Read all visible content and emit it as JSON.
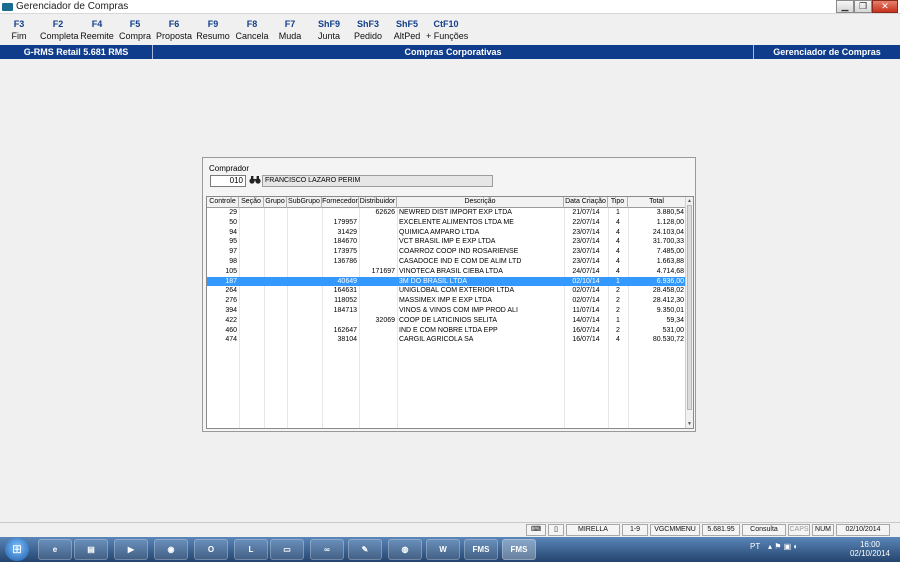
{
  "window": {
    "title": "Gerenciador de Compras"
  },
  "fkeys": [
    {
      "key": "F3",
      "label": "Fim"
    },
    {
      "key": "F2",
      "label": "Completa"
    },
    {
      "key": "F4",
      "label": "Reemite"
    },
    {
      "key": "F5",
      "label": "Compra"
    },
    {
      "key": "F6",
      "label": "Proposta"
    },
    {
      "key": "F9",
      "label": "Resumo"
    },
    {
      "key": "F8",
      "label": "Cancela"
    },
    {
      "key": "F7",
      "label": "Muda"
    },
    {
      "key": "ShF9",
      "label": "Junta"
    },
    {
      "key": "ShF3",
      "label": "Pedido"
    },
    {
      "key": "ShF5",
      "label": "AltPed"
    },
    {
      "key": "CtF10",
      "label": "+ Funções"
    }
  ],
  "top_status": {
    "left": "G-RMS Retail 5.681 RMS",
    "center": "Compras Corporativas",
    "right": "Gerenciador de Compras"
  },
  "comprador": {
    "label": "Comprador",
    "code": "010",
    "name": "FRANCISCO LAZARO PERIM"
  },
  "table": {
    "columns": [
      "Controle",
      "Seção",
      "Grupo",
      "SubGrupo",
      "Fornecedor",
      "Distribuidor",
      "Descrição",
      "Data Criação",
      "Tipo",
      "Total"
    ],
    "selected_index": 7,
    "rows": [
      [
        "29",
        "",
        "",
        "",
        "",
        "62626",
        "NEWRED DIST IMPORT EXP LTDA",
        "21/07/14",
        "1",
        "3.880,54"
      ],
      [
        "50",
        "",
        "",
        "",
        "179957",
        "",
        "EXCELENTE ALIMENTOS LTDA ME",
        "22/07/14",
        "4",
        "1.128,00"
      ],
      [
        "94",
        "",
        "",
        "",
        "31429",
        "",
        "QUIMICA AMPARO LTDA",
        "23/07/14",
        "4",
        "24.103,04"
      ],
      [
        "95",
        "",
        "",
        "",
        "184670",
        "",
        "VCT BRASIL IMP E EXP LTDA",
        "23/07/14",
        "4",
        "31.700,33"
      ],
      [
        "97",
        "",
        "",
        "",
        "173975",
        "",
        "COARROZ COOP IND ROSARIENSE",
        "23/07/14",
        "4",
        "7.485,00"
      ],
      [
        "98",
        "",
        "",
        "",
        "136786",
        "",
        "CASADOCE IND E COM DE ALIM LTD",
        "23/07/14",
        "4",
        "1.663,88"
      ],
      [
        "105",
        "",
        "",
        "",
        "",
        "171697",
        "VINOTECA BRASIL CIEBA LTDA",
        "24/07/14",
        "4",
        "4.714,68"
      ],
      [
        "187",
        "",
        "",
        "",
        "40649",
        "",
        "3M DO BRASIL LTDA",
        "02/10/14",
        "1",
        "6.936,00"
      ],
      [
        "264",
        "",
        "",
        "",
        "164631",
        "",
        "UNIGLOBAL COM EXTERIOR LTDA",
        "02/07/14",
        "2",
        "28.458,02"
      ],
      [
        "276",
        "",
        "",
        "",
        "118052",
        "",
        "MASSIMEX IMP E EXP LTDA",
        "02/07/14",
        "2",
        "28.412,30"
      ],
      [
        "394",
        "",
        "",
        "",
        "184713",
        "",
        "VINOS & VINOS COM IMP PROD ALI",
        "11/07/14",
        "2",
        "9.350,01"
      ],
      [
        "422",
        "",
        "",
        "",
        "",
        "32069",
        "COOP DE LATICINIOS SELITA",
        "14/07/14",
        "1",
        "59,34"
      ],
      [
        "460",
        "",
        "",
        "",
        "162647",
        "",
        "IND E COM NOBRE LTDA EPP",
        "16/07/14",
        "2",
        "531,00"
      ],
      [
        "474",
        "",
        "",
        "",
        "38104",
        "",
        "CARGIL AGRICOLA SA",
        "16/07/14",
        "4",
        "80.530,72"
      ]
    ]
  },
  "bottom_status": {
    "user": "MIRELLA",
    "range": "1-9",
    "menu": "VGCMMENU",
    "version": "5.681.95",
    "mode": "Consulta",
    "caps": "CAPS",
    "num": "NUM",
    "date": "02/10/2014"
  },
  "taskbar": {
    "lang": "PT",
    "time": "16:00",
    "date": "02/10/2014",
    "fms1": "FMS",
    "fms2": "FMS"
  }
}
